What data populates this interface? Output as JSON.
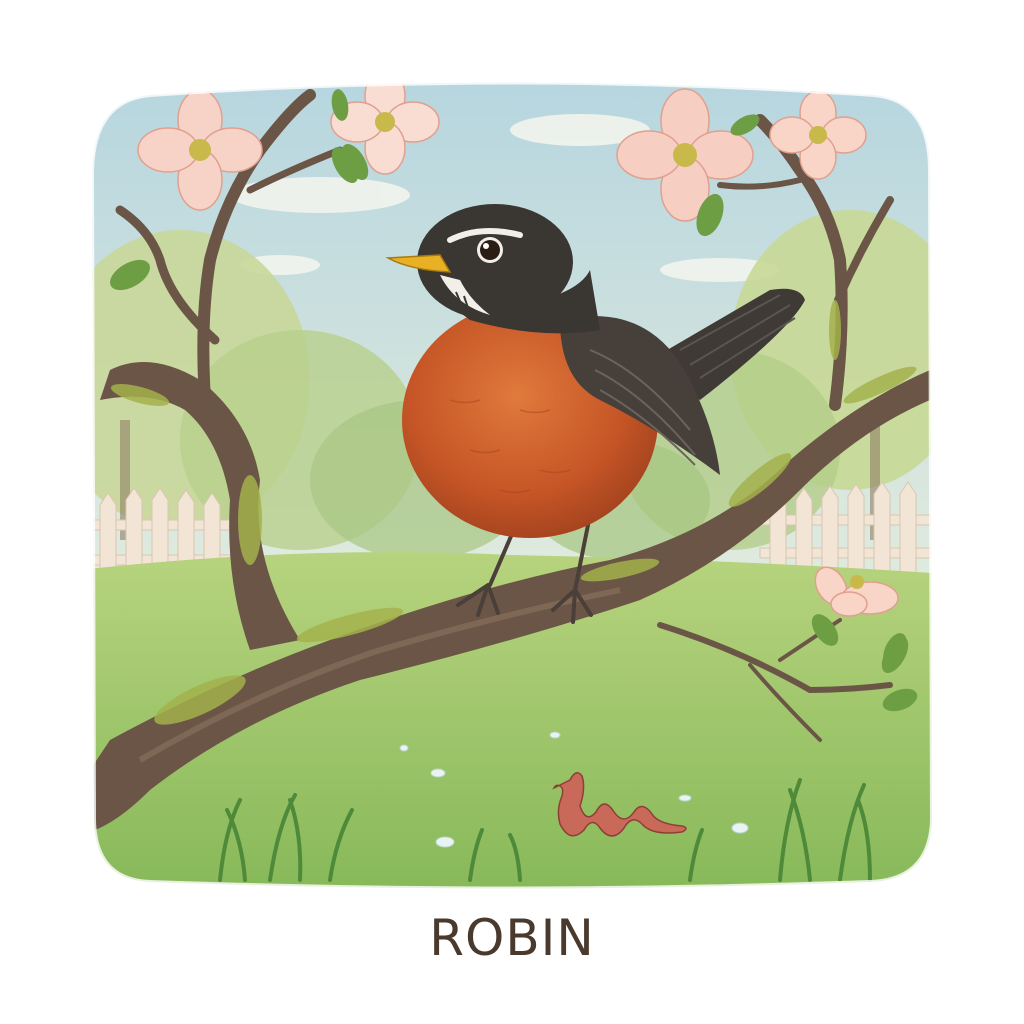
{
  "caption": "ROBIN",
  "colors": {
    "sky_top": "#bcd8de",
    "sky_bottom": "#e8efd9",
    "grass": "#9cc46b",
    "grass_dark": "#6ea44a",
    "robin_breast": "#c85a2a",
    "robin_head": "#3a3632",
    "branch": "#6b5546",
    "moss": "#a3b24c",
    "blossom": "#f4c4b6",
    "fence": "#f0e2d2",
    "caption_text": "#4a3a2e"
  },
  "icons": [
    "robin-bird",
    "dogwood-blossom",
    "earthworm",
    "tree-branch",
    "picket-fence"
  ]
}
